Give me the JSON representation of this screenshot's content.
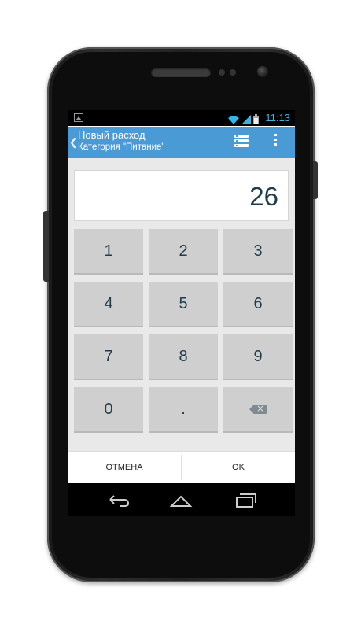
{
  "statusbar": {
    "time": "11:13",
    "icons": [
      "gallery-icon",
      "wifi-icon",
      "signal-icon",
      "battery-icon"
    ]
  },
  "actionbar": {
    "title": "Новый расход",
    "subtitle": "Категория \"Питание\"",
    "icons": [
      "back-chevron-icon",
      "list-icon",
      "overflow-menu-icon"
    ]
  },
  "display": {
    "value": "26"
  },
  "keypad": {
    "keys": [
      "1",
      "2",
      "3",
      "4",
      "5",
      "6",
      "7",
      "8",
      "9",
      "0",
      "."
    ],
    "backspace_icon": "backspace-icon"
  },
  "dialog": {
    "cancel_label": "ОТМЕНА",
    "ok_label": "OK"
  },
  "navbar": {
    "icons": [
      "back-icon",
      "home-icon",
      "recent-apps-icon"
    ]
  },
  "colors": {
    "actionbar": "#4a9ad6",
    "status_accent": "#33b5e5",
    "key_bg": "#cfcfcf",
    "key_text": "#1f3d4d"
  }
}
